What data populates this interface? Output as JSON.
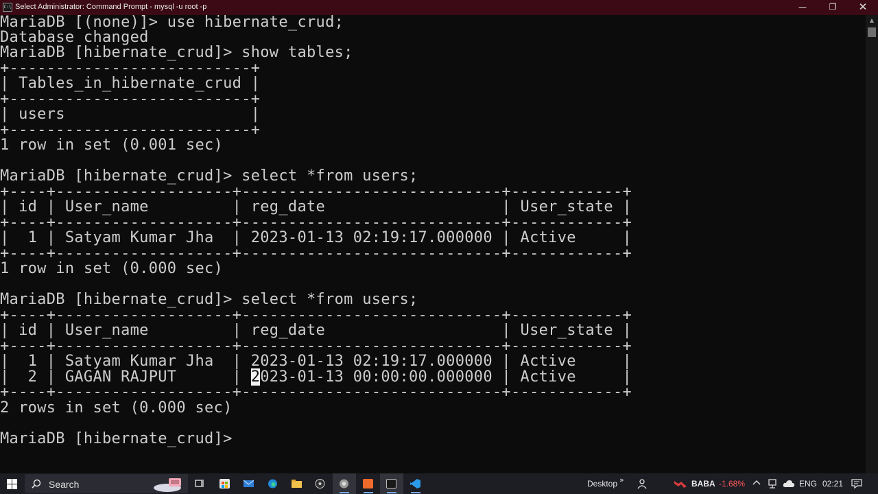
{
  "window": {
    "title": "Select Administrator: Command Prompt - mysql  -u root -p",
    "icon": "cmd-icon",
    "controls": {
      "minimize": "—",
      "maximize": "❐",
      "close": "✕"
    }
  },
  "console": {
    "lines": [
      "MariaDB [(none)]> use hibernate_crud;",
      "Database changed",
      "MariaDB [hibernate_crud]> show tables;",
      "+--------------------------+",
      "| Tables_in_hibernate_crud |",
      "+--------------------------+",
      "| users                    |",
      "+--------------------------+",
      "1 row in set (0.001 sec)",
      "",
      "MariaDB [hibernate_crud]> select *from users;",
      "+----+-------------------+----------------------------+------------+",
      "| id | User_name         | reg_date                   | User_state |",
      "+----+-------------------+----------------------------+------------+",
      "|  1 | Satyam Kumar Jha  | 2023-01-13 02:19:17.000000 | Active     |",
      "+----+-------------------+----------------------------+------------+",
      "1 row in set (0.000 sec)",
      "",
      "MariaDB [hibernate_crud]> select *from users;",
      "+----+-------------------+----------------------------+------------+",
      "| id | User_name         | reg_date                   | User_state |",
      "+----+-------------------+----------------------------+------------+",
      "|  1 | Satyam Kumar Jha  | 2023-01-13 02:19:17.000000 | Active     |",
      "|  2 | GAGAN RAJPUT      | ",
      "+----+-------------------+----------------------------+------------+",
      "2 rows in set (0.000 sec)",
      "",
      "MariaDB [hibernate_crud]> "
    ],
    "cursor_line": {
      "before": "|  2 | GAGAN RAJPUT      | ",
      "cursor_char": "2",
      "after": "023-01-13 00:00:00.000000 | Active     |"
    }
  },
  "taskbar": {
    "start_icon": "windows-logo-icon",
    "search_label": "Search",
    "pinned": [
      {
        "name": "task-view-icon"
      },
      {
        "name": "store-icon"
      },
      {
        "name": "mail-icon"
      },
      {
        "name": "edge-icon"
      },
      {
        "name": "file-explorer-icon"
      },
      {
        "name": "obs-icon"
      },
      {
        "name": "chrome-icon"
      },
      {
        "name": "sublime-icon"
      },
      {
        "name": "cmd-icon"
      },
      {
        "name": "vscode-icon"
      }
    ],
    "tray": {
      "desktop_label": "Desktop",
      "chevron": "»",
      "stock_name": "BABA",
      "stock_change": "-1.68%",
      "language": "ENG",
      "time": "02:21"
    }
  },
  "colors": {
    "console_bg": "#0c0c0c",
    "console_text": "#cccccc",
    "titlebar_bg": "#3b0a14",
    "taskbar_bg": "#1d1d24",
    "stock_negative": "#ff5a5a"
  }
}
